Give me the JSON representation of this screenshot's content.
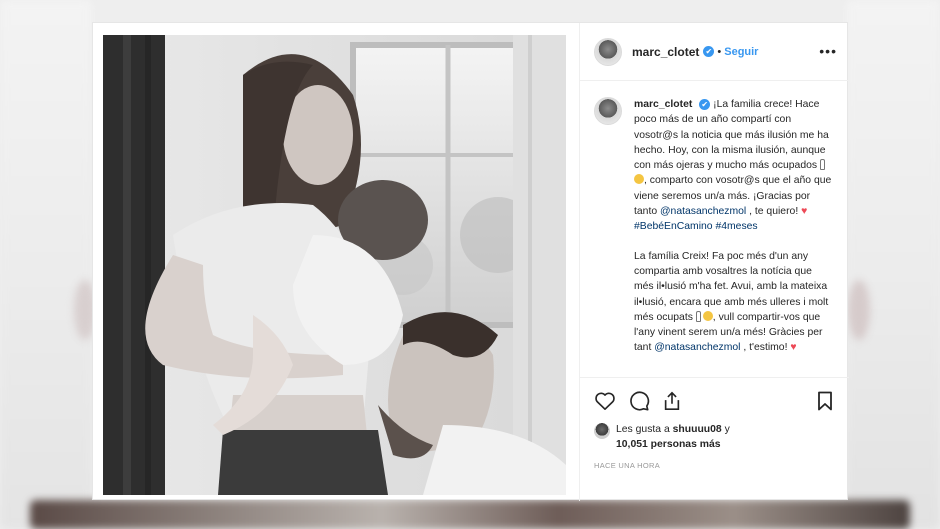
{
  "post": {
    "username": "marc_clotet",
    "verified_mark": "✔",
    "separator": "•",
    "follow_label": "Seguir",
    "more_label": "•••",
    "caption": {
      "p1_a": "¡La familia crece! Hace poco más de un año compartí con vosotr@s la noticia que más ilusión me ha hecho. Hoy, con la misma ilusión, aunque con más ojeras y mucho más ocupados ",
      "p1_b": ", comparto con vosotr@s que el año que viene seremos un/a más. ¡Gracias por tanto ",
      "mention": "@natasanchezmol",
      "p1_c": " , te quiero! ",
      "heart": "♥",
      "hashtag1": "#BebéEnCamino",
      "hashtag2": "#4meses",
      "p2_a": "La família Creix! Fa poc més d'un any compartia amb vosaltres la notícia que més il•lusió m'ha fet. Avui, amb la mateixa il•lusió, encara que amb més ulleres i molt més ocupats ",
      "p2_b": ", vull compartir-vos que l'any vinent serem un/a més! Gràcies per tant ",
      "p2_mention": "@natasanchezmol",
      "p2_c": " , t'estimo! "
    },
    "likes": {
      "prefix": "Les gusta a ",
      "user": "shuuuu08",
      "conj": " y",
      "count": "10,051 personas más"
    },
    "timestamp": "HACE UNA HORA"
  },
  "icons": {
    "like": "heart-outline-icon",
    "comment": "comment-icon",
    "share": "share-icon",
    "save": "bookmark-icon",
    "more": "more-icon"
  },
  "colors": {
    "link_blue": "#3897f0",
    "hashtag": "#003569",
    "heart_red": "#ed4956"
  }
}
